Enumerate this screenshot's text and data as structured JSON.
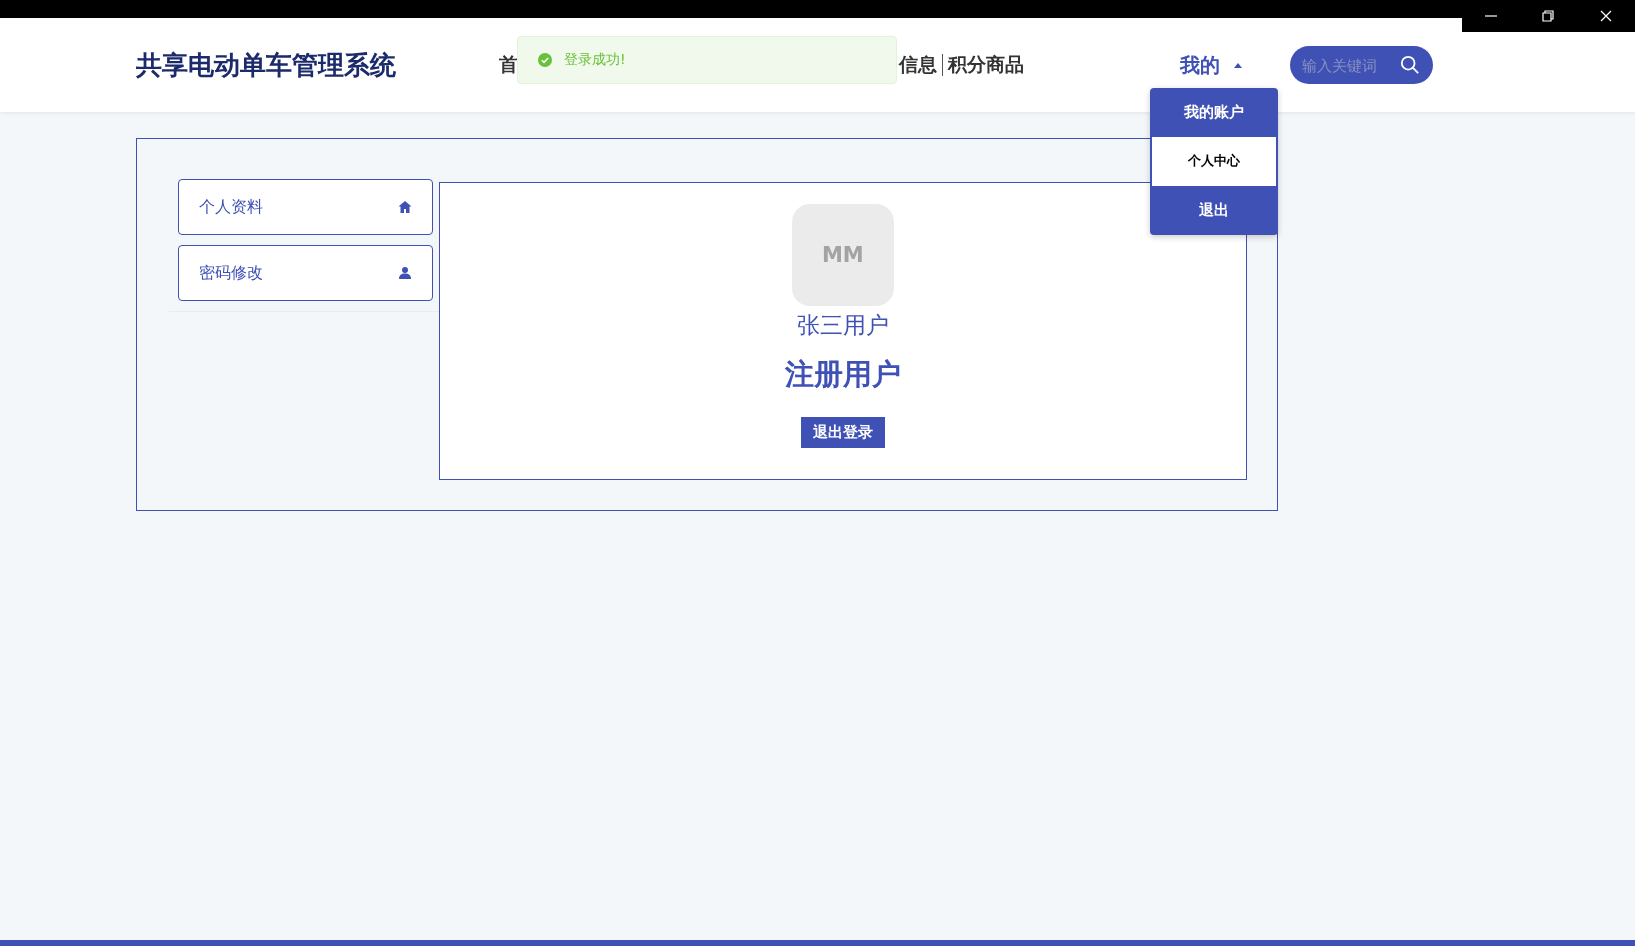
{
  "header": {
    "logo": "共享电动单车管理系统",
    "nav": [
      {
        "label": "首",
        "selected": false
      },
      {
        "label": "信息",
        "selected": false
      },
      {
        "label": "积分商品",
        "selected": false
      }
    ],
    "account_menu": {
      "label": "我的",
      "expanded": true,
      "items": [
        {
          "label": "我的账户",
          "selected": false
        },
        {
          "label": "个人中心",
          "selected": true
        },
        {
          "label": "退出",
          "selected": false
        }
      ]
    },
    "search": {
      "placeholder": "输入关键词"
    }
  },
  "toast": {
    "kind": "success",
    "text": "登录成功!"
  },
  "sidebar": {
    "items": [
      {
        "label": "个人资料"
      },
      {
        "label": "密码修改"
      }
    ]
  },
  "profile": {
    "avatar": "MM",
    "name": "张三用户",
    "role": "注册用户",
    "logout_button": "退出登录"
  }
}
